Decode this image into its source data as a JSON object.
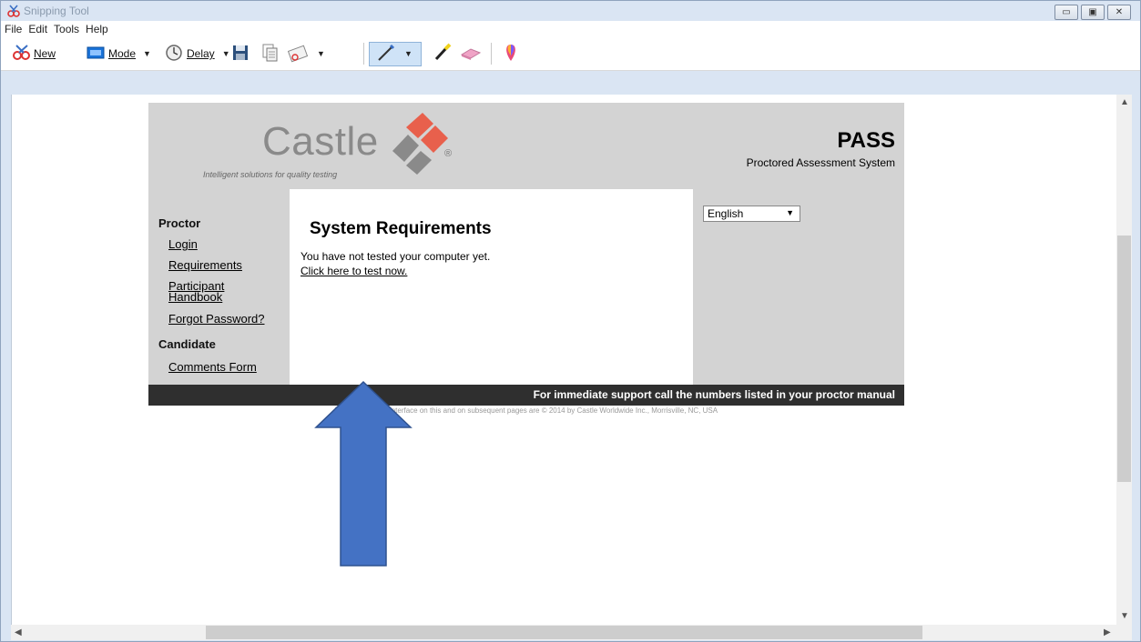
{
  "window": {
    "title": "Snipping Tool"
  },
  "menu": [
    "File",
    "Edit",
    "Tools",
    "Help"
  ],
  "toolbar": {
    "new_label": "New",
    "mode_label": "Mode",
    "delay_label": "Delay"
  },
  "page": {
    "logo": {
      "word": "Castle",
      "tagline": "Intelligent solutions for quality testing",
      "mark": "®"
    },
    "product": {
      "name": "PASS",
      "subtitle": "Proctored Assessment System"
    },
    "proctor_heading": "Proctor",
    "proctor_links": [
      "Login",
      "Requirements",
      "Participant Handbook",
      "Forgot Password?"
    ],
    "candidate_heading": "Candidate",
    "candidate_links": [
      "Comments Form"
    ],
    "main_heading": "System Requirements",
    "message": "You have not tested your computer yet.",
    "test_link": "Click here to test now.",
    "language": "English",
    "footer": "For immediate support call the numbers listed in your proctor manual",
    "copyright": "The content and interface on this and on subsequent pages are © 2014 by Castle Worldwide Inc., Morrisville, NC, USA"
  },
  "colors": {
    "arrow": "#4472c4",
    "footer_bg": "#2f2f2f",
    "panel_bg": "#d3d3d3",
    "logo_accent": "#e8604c"
  }
}
